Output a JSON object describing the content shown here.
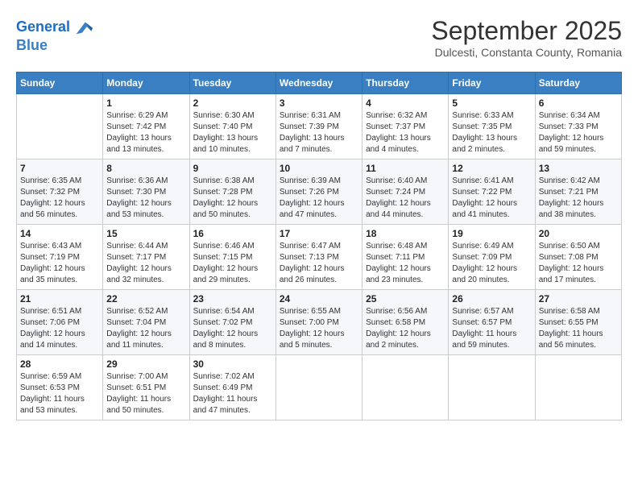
{
  "header": {
    "logo_line1": "General",
    "logo_line2": "Blue",
    "month": "September 2025",
    "location": "Dulcesti, Constanta County, Romania"
  },
  "weekdays": [
    "Sunday",
    "Monday",
    "Tuesday",
    "Wednesday",
    "Thursday",
    "Friday",
    "Saturday"
  ],
  "weeks": [
    [
      {
        "day": "",
        "info": ""
      },
      {
        "day": "1",
        "info": "Sunrise: 6:29 AM\nSunset: 7:42 PM\nDaylight: 13 hours\nand 13 minutes."
      },
      {
        "day": "2",
        "info": "Sunrise: 6:30 AM\nSunset: 7:40 PM\nDaylight: 13 hours\nand 10 minutes."
      },
      {
        "day": "3",
        "info": "Sunrise: 6:31 AM\nSunset: 7:39 PM\nDaylight: 13 hours\nand 7 minutes."
      },
      {
        "day": "4",
        "info": "Sunrise: 6:32 AM\nSunset: 7:37 PM\nDaylight: 13 hours\nand 4 minutes."
      },
      {
        "day": "5",
        "info": "Sunrise: 6:33 AM\nSunset: 7:35 PM\nDaylight: 13 hours\nand 2 minutes."
      },
      {
        "day": "6",
        "info": "Sunrise: 6:34 AM\nSunset: 7:33 PM\nDaylight: 12 hours\nand 59 minutes."
      }
    ],
    [
      {
        "day": "7",
        "info": "Sunrise: 6:35 AM\nSunset: 7:32 PM\nDaylight: 12 hours\nand 56 minutes."
      },
      {
        "day": "8",
        "info": "Sunrise: 6:36 AM\nSunset: 7:30 PM\nDaylight: 12 hours\nand 53 minutes."
      },
      {
        "day": "9",
        "info": "Sunrise: 6:38 AM\nSunset: 7:28 PM\nDaylight: 12 hours\nand 50 minutes."
      },
      {
        "day": "10",
        "info": "Sunrise: 6:39 AM\nSunset: 7:26 PM\nDaylight: 12 hours\nand 47 minutes."
      },
      {
        "day": "11",
        "info": "Sunrise: 6:40 AM\nSunset: 7:24 PM\nDaylight: 12 hours\nand 44 minutes."
      },
      {
        "day": "12",
        "info": "Sunrise: 6:41 AM\nSunset: 7:22 PM\nDaylight: 12 hours\nand 41 minutes."
      },
      {
        "day": "13",
        "info": "Sunrise: 6:42 AM\nSunset: 7:21 PM\nDaylight: 12 hours\nand 38 minutes."
      }
    ],
    [
      {
        "day": "14",
        "info": "Sunrise: 6:43 AM\nSunset: 7:19 PM\nDaylight: 12 hours\nand 35 minutes."
      },
      {
        "day": "15",
        "info": "Sunrise: 6:44 AM\nSunset: 7:17 PM\nDaylight: 12 hours\nand 32 minutes."
      },
      {
        "day": "16",
        "info": "Sunrise: 6:46 AM\nSunset: 7:15 PM\nDaylight: 12 hours\nand 29 minutes."
      },
      {
        "day": "17",
        "info": "Sunrise: 6:47 AM\nSunset: 7:13 PM\nDaylight: 12 hours\nand 26 minutes."
      },
      {
        "day": "18",
        "info": "Sunrise: 6:48 AM\nSunset: 7:11 PM\nDaylight: 12 hours\nand 23 minutes."
      },
      {
        "day": "19",
        "info": "Sunrise: 6:49 AM\nSunset: 7:09 PM\nDaylight: 12 hours\nand 20 minutes."
      },
      {
        "day": "20",
        "info": "Sunrise: 6:50 AM\nSunset: 7:08 PM\nDaylight: 12 hours\nand 17 minutes."
      }
    ],
    [
      {
        "day": "21",
        "info": "Sunrise: 6:51 AM\nSunset: 7:06 PM\nDaylight: 12 hours\nand 14 minutes."
      },
      {
        "day": "22",
        "info": "Sunrise: 6:52 AM\nSunset: 7:04 PM\nDaylight: 12 hours\nand 11 minutes."
      },
      {
        "day": "23",
        "info": "Sunrise: 6:54 AM\nSunset: 7:02 PM\nDaylight: 12 hours\nand 8 minutes."
      },
      {
        "day": "24",
        "info": "Sunrise: 6:55 AM\nSunset: 7:00 PM\nDaylight: 12 hours\nand 5 minutes."
      },
      {
        "day": "25",
        "info": "Sunrise: 6:56 AM\nSunset: 6:58 PM\nDaylight: 12 hours\nand 2 minutes."
      },
      {
        "day": "26",
        "info": "Sunrise: 6:57 AM\nSunset: 6:57 PM\nDaylight: 11 hours\nand 59 minutes."
      },
      {
        "day": "27",
        "info": "Sunrise: 6:58 AM\nSunset: 6:55 PM\nDaylight: 11 hours\nand 56 minutes."
      }
    ],
    [
      {
        "day": "28",
        "info": "Sunrise: 6:59 AM\nSunset: 6:53 PM\nDaylight: 11 hours\nand 53 minutes."
      },
      {
        "day": "29",
        "info": "Sunrise: 7:00 AM\nSunset: 6:51 PM\nDaylight: 11 hours\nand 50 minutes."
      },
      {
        "day": "30",
        "info": "Sunrise: 7:02 AM\nSunset: 6:49 PM\nDaylight: 11 hours\nand 47 minutes."
      },
      {
        "day": "",
        "info": ""
      },
      {
        "day": "",
        "info": ""
      },
      {
        "day": "",
        "info": ""
      },
      {
        "day": "",
        "info": ""
      }
    ]
  ]
}
